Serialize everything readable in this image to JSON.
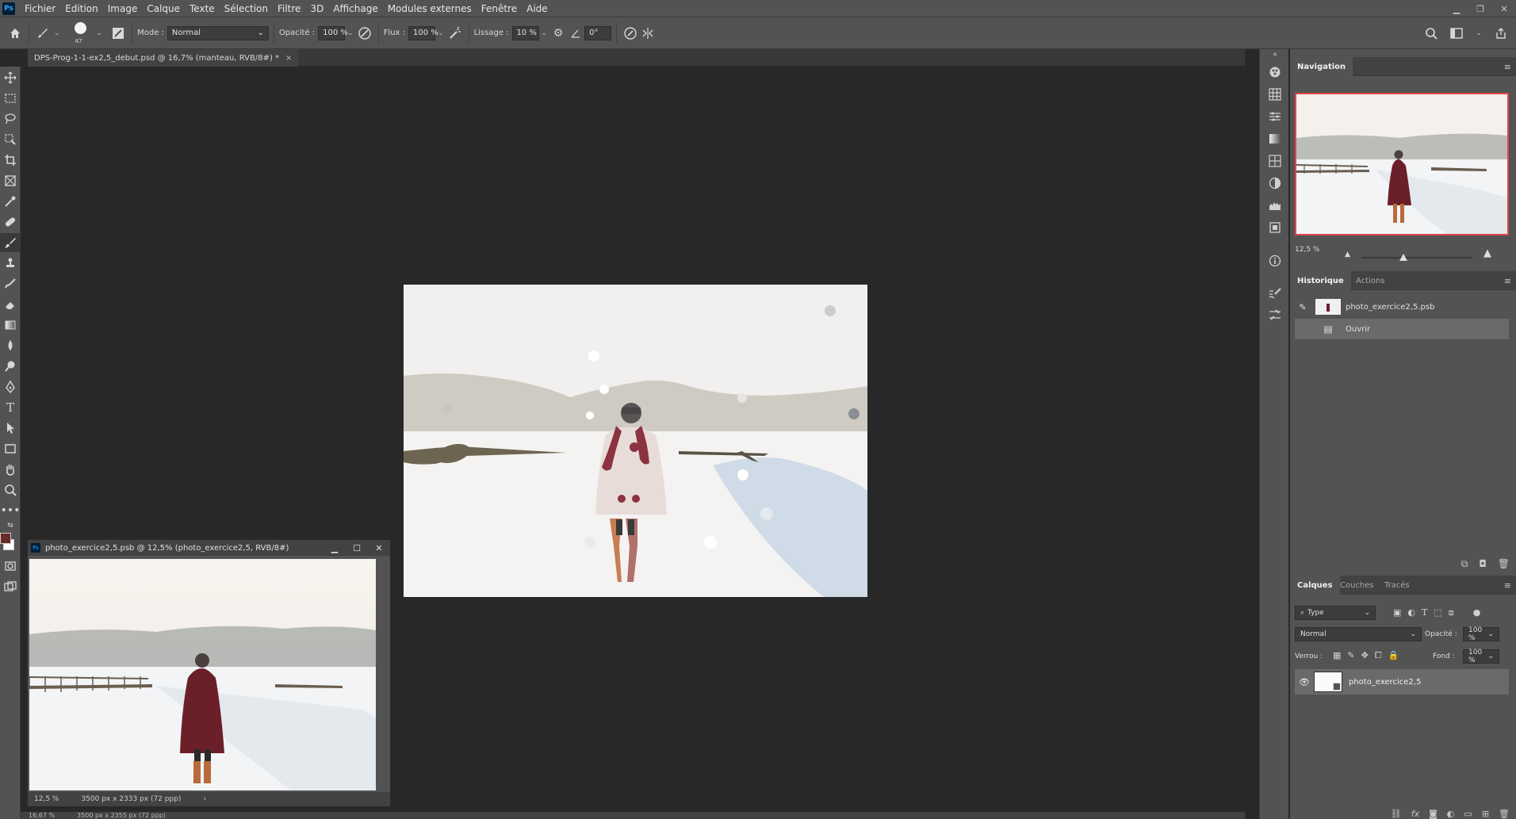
{
  "app": {
    "logo": "Ps"
  },
  "menu": [
    "Fichier",
    "Edition",
    "Image",
    "Calque",
    "Texte",
    "Sélection",
    "Filtre",
    "3D",
    "Affichage",
    "Modules externes",
    "Fenêtre",
    "Aide"
  ],
  "options": {
    "brush_size": "47",
    "mode_label": "Mode :",
    "mode_value": "Normal",
    "opacity_label": "Opacité :",
    "opacity_value": "100 %",
    "flux_label": "Flux :",
    "flux_value": "100 %",
    "lissage_label": "Lissage :",
    "lissage_value": "10 %",
    "angle_value": "0°"
  },
  "document": {
    "tab_title": "DPS-Prog-1-1-ex2,5_debut.psd @ 16,7% (manteau, RVB/8#) *",
    "tab_close": "×",
    "status_zoom": "16,67 %",
    "status_info": "3500 px x 2355 px (72 ppp)"
  },
  "subwindow": {
    "title": "photo_exercice2,5.psb @ 12,5% (photo_exercice2,5, RVB/8#)",
    "zoom": "12,5 %",
    "info": "3500 px x 2333 px (72 ppp)",
    "arrow": "›"
  },
  "navigation": {
    "tab": "Navigation",
    "zoom": "12,5 %"
  },
  "history": {
    "tabs": [
      "Historique",
      "Actions"
    ],
    "snapshot": "photo_exercice2,5.psb",
    "step": "Ouvrir"
  },
  "layers": {
    "tabs": [
      "Calques",
      "Couches",
      "Tracés"
    ],
    "filter_value": "Type",
    "blend_value": "Normal",
    "opacity_label": "Opacité :",
    "opacity_value": "100 %",
    "lock_label": "Verrou :",
    "fill_label": "Fond :",
    "fill_value": "100 %",
    "layer_name": "photo_exercice2,5"
  },
  "colors": {
    "foreground": "#6b2a2a",
    "background": "#ffffff",
    "accent": "#e04646"
  }
}
